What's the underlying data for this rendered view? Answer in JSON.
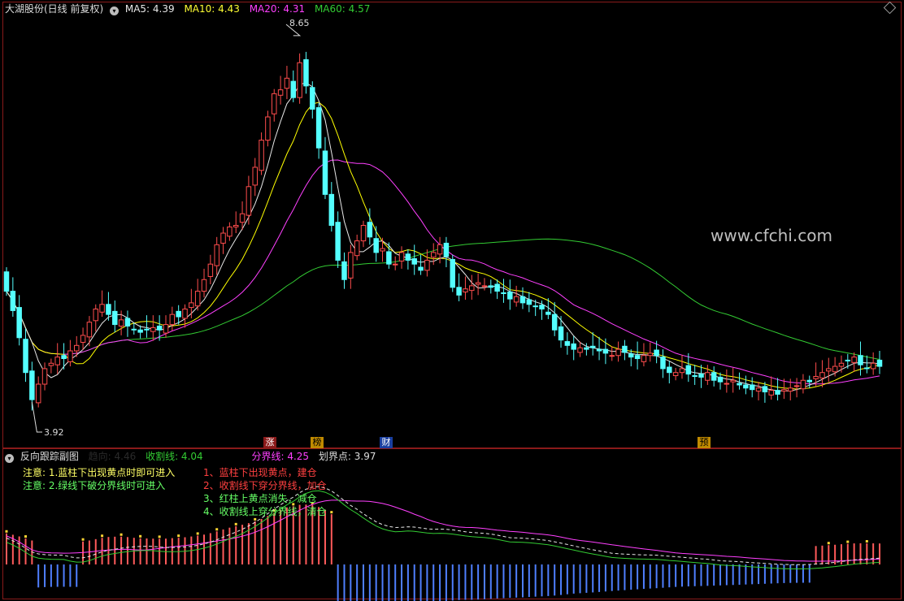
{
  "header": {
    "stock_title": "大湖股份(日线 前复权)",
    "ma5": "MA5: 4.39",
    "ma10": "MA10: 4.43",
    "ma20": "MA20: 4.31",
    "ma60": "MA60: 4.57"
  },
  "indicator_header": {
    "name": "反向跟踪副图",
    "dim_label": "趋向: 4.46",
    "cut_line": "收割线: 4.04",
    "divide_line": "分界线: 4.25",
    "mark_point": "划界点: 3.97"
  },
  "notes_left": [
    "注意: 1.蓝柱下出现黄点时即可进入",
    "注意: 2.绿线下破分界线时可进入"
  ],
  "notes_right": [
    "1、蓝柱下出现黄点，建仓",
    "2、收割线下穿分界线，加仓",
    "3、红柱上黄点消失，减仓",
    "4、收割线上穿分界线，清仓"
  ],
  "price_labels": {
    "high": "8.65",
    "low": "3.92"
  },
  "event_markers": [
    "涨",
    "榜",
    "财",
    "预"
  ],
  "watermark": "www.cfchi.com",
  "colors": {
    "up": "#ff4d4d",
    "down": "#54ffff",
    "ma5": "#e8e8e8",
    "ma10": "#ffff00",
    "ma20": "#ff40ff",
    "ma60": "#33cc33",
    "bar_blue": "#4f7fff",
    "bar_red": "#ff5a5a",
    "dot_yellow": "#ffd633"
  },
  "chart_data": [
    {
      "type": "candlestick",
      "title": "大湖股份(日线 前复权)",
      "ylim": [
        3.5,
        8.9
      ],
      "grid": false,
      "series": [
        {
          "name": "MA5",
          "last": 4.39
        },
        {
          "name": "MA10",
          "last": 4.43
        },
        {
          "name": "MA20",
          "last": 4.31
        },
        {
          "name": "MA60",
          "last": 4.57
        }
      ],
      "close": [
        5.35,
        5.1,
        4.75,
        4.3,
        3.95,
        4.15,
        4.35,
        4.42,
        4.5,
        4.48,
        4.58,
        4.65,
        4.78,
        4.95,
        5.12,
        5.18,
        5.05,
        4.92,
        4.98,
        4.9,
        4.85,
        4.82,
        4.85,
        4.88,
        4.85,
        4.92,
        5.05,
        5.02,
        5.12,
        5.2,
        5.35,
        5.5,
        5.7,
        5.95,
        6.1,
        6.18,
        6.2,
        6.35,
        6.7,
        6.95,
        7.3,
        7.6,
        7.9,
        7.95,
        8.1,
        7.85,
        8.3,
        8.0,
        7.7,
        7.2,
        6.6,
        6.2,
        5.75,
        5.5,
        5.85,
        6.0,
        6.2,
        6.05,
        5.85,
        5.9,
        5.7,
        5.7,
        5.85,
        5.75,
        5.7,
        5.62,
        5.75,
        5.85,
        5.95,
        5.8,
        5.4,
        5.3,
        5.38,
        5.42,
        5.46,
        5.42,
        5.4,
        5.35,
        5.32,
        5.25,
        5.28,
        5.2,
        5.18,
        5.15,
        5.12,
        5.05,
        4.85,
        4.72,
        4.65,
        4.6,
        4.62,
        4.6,
        4.62,
        4.58,
        4.55,
        4.52,
        4.6,
        4.56,
        4.5,
        4.48,
        4.52,
        4.55,
        4.52,
        4.35,
        4.3,
        4.3,
        4.35,
        4.28,
        4.26,
        4.24,
        4.3,
        4.2,
        4.18,
        4.16,
        4.2,
        4.14,
        4.1,
        4.08,
        4.1,
        4.05,
        4.07,
        4.02,
        4.08,
        4.1,
        4.13,
        4.2,
        4.18,
        4.25,
        4.3,
        4.35,
        4.38,
        4.42,
        4.45,
        4.5,
        4.4,
        4.35,
        4.42,
        4.38
      ],
      "high_label": 8.65,
      "low_label": 3.92
    },
    {
      "type": "bar",
      "title": "反向跟踪副图",
      "series": [
        {
          "name": "趋向",
          "last": 4.46
        },
        {
          "name": "收割线",
          "last": 4.04
        },
        {
          "name": "分界线",
          "last": 4.25
        },
        {
          "name": "划界点",
          "last": 3.97
        }
      ]
    }
  ]
}
